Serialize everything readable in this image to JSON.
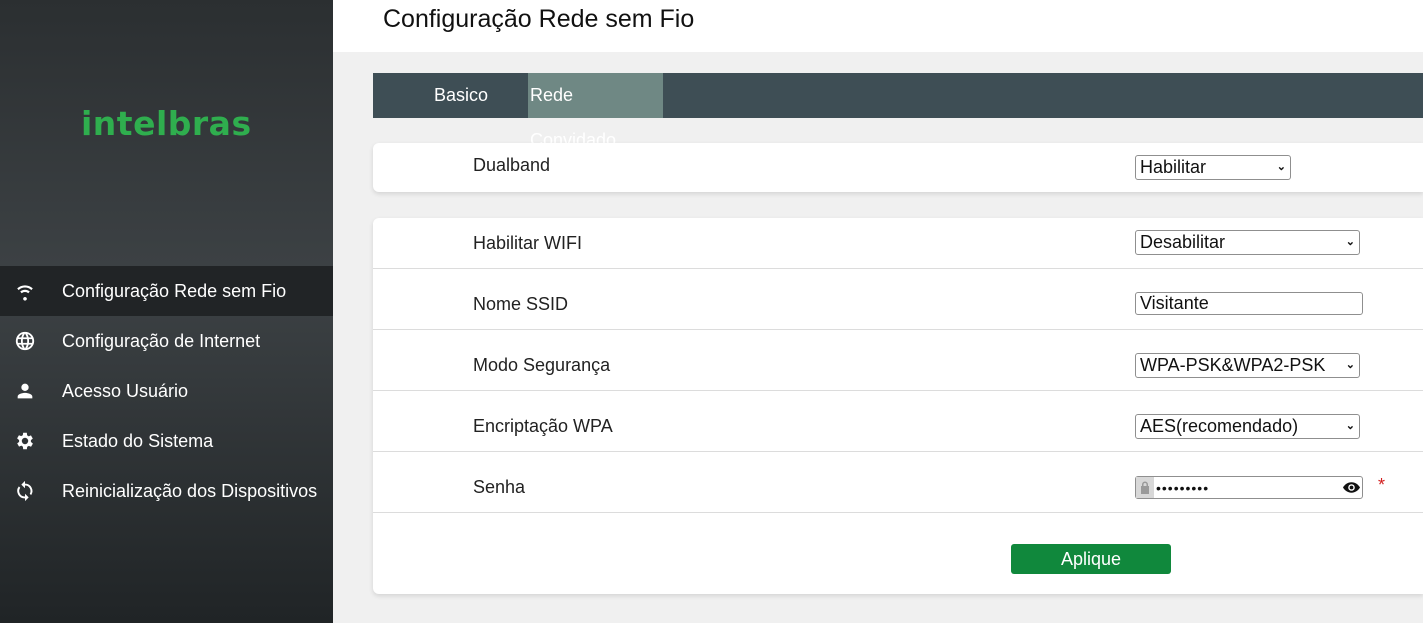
{
  "brand": {
    "logo_text": "intelbras",
    "logo_color": "#2fae4e"
  },
  "sidebar": {
    "items": [
      {
        "label": "Configuração Rede sem Fio",
        "icon": "wifi-icon",
        "active": true
      },
      {
        "label": "Configuração de Internet",
        "icon": "globe-icon",
        "active": false
      },
      {
        "label": "Acesso Usuário",
        "icon": "user-icon",
        "active": false
      },
      {
        "label": "Estado do Sistema",
        "icon": "gear-icon",
        "active": false
      },
      {
        "label": "Reinicialização dos Dispositivos",
        "icon": "restart-icon",
        "active": false
      }
    ]
  },
  "header": {
    "title": "Configuração Rede sem Fio"
  },
  "tabs": [
    {
      "label": "Basico",
      "active": false
    },
    {
      "label": "Rede Convidado",
      "active": true
    }
  ],
  "dualband": {
    "label": "Dualband",
    "value": "Habilitar"
  },
  "form": {
    "wifi": {
      "label": "Habilitar WIFI",
      "value": "Desabilitar"
    },
    "ssid": {
      "label": "Nome SSID",
      "value": "Visitante"
    },
    "security": {
      "label": "Modo Segurança",
      "value": "WPA-PSK&WPA2-PSK"
    },
    "encryption": {
      "label": "Encriptação WPA",
      "value": "AES(recomendado)"
    },
    "password": {
      "label": "Senha",
      "masked": "•••••••••",
      "required_mark": "*"
    }
  },
  "apply_button": {
    "label": "Aplique"
  },
  "colors": {
    "accent": "#10883c",
    "tab_bar": "#3e4e55",
    "tab_active": "#6f8884",
    "required": "#d21f1f"
  }
}
